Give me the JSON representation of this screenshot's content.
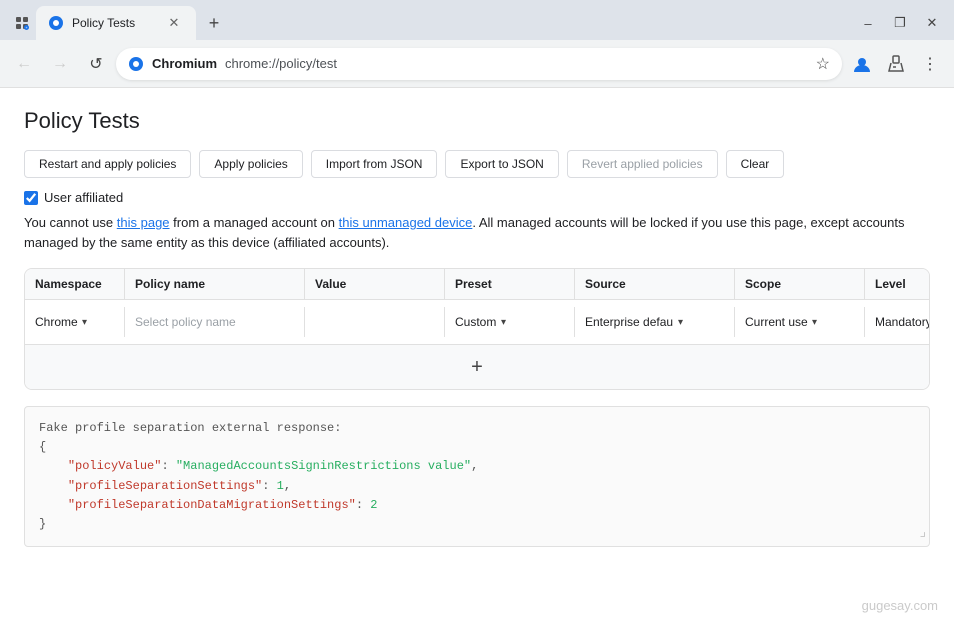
{
  "browser": {
    "tab_title": "Policy Tests",
    "omnibox_site": "Chromium",
    "omnibox_url": "chrome://policy/test",
    "new_tab_label": "+",
    "minimize_label": "–",
    "maximize_label": "❐",
    "close_label": "✕",
    "back_label": "←",
    "forward_label": "→",
    "refresh_label": "↺"
  },
  "page": {
    "title": "Policy Tests"
  },
  "toolbar": {
    "btn_restart": "Restart and apply policies",
    "btn_apply": "Apply policies",
    "btn_import": "Import from JSON",
    "btn_export": "Export to JSON",
    "btn_revert": "Revert applied policies",
    "btn_clear": "Clear"
  },
  "user_affiliated": {
    "label": "User affiliated"
  },
  "warning": {
    "text_part1": "You cannot use this page from a managed account on this unmanaged device. All managed accounts will be locked if you use this page, except accounts managed by the same entity as this device (affiliated accounts)."
  },
  "table": {
    "headers": [
      "Namespace",
      "Policy name",
      "Value",
      "Preset",
      "Source",
      "Scope",
      "Level",
      ""
    ],
    "row": {
      "namespace": "Chrome",
      "policy_name_placeholder": "Select policy name",
      "value": "",
      "preset": "Custom",
      "source": "Enterprise defau",
      "scope": "Current use",
      "level": "Mandatory"
    },
    "add_btn": "+"
  },
  "code_block": {
    "line1": "Fake profile separation external response:",
    "line2": "  {",
    "line3": "    \"policyValue\": \"ManagedAccountsSigninRestrictions value\",",
    "line4": "    \"profileSeparationSettings\": 1,",
    "line5": "    \"profileSeparationDataMigrationSettings\": 2",
    "line6": "  }"
  },
  "watermark": "gugesay.com"
}
